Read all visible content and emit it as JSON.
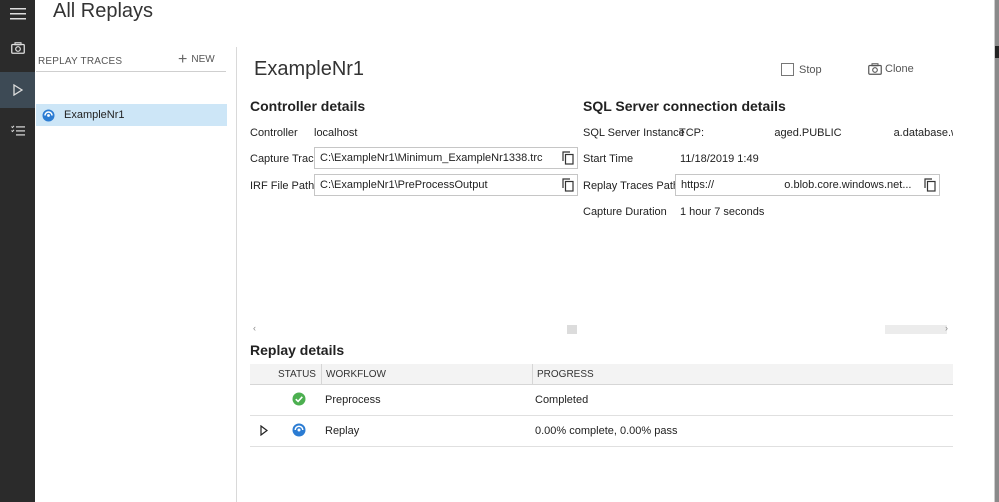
{
  "app": {
    "title": "All Replays"
  },
  "traces": {
    "header": "REPLAY TRACES",
    "new_label": "NEW",
    "items": [
      {
        "label": "ExampleNr1"
      }
    ]
  },
  "detail": {
    "title": "ExampleNr1",
    "stop_label": "Stop",
    "clone_label": "Clone",
    "controller": {
      "heading": "Controller details",
      "controller_label": "Controller",
      "controller_value": "localhost",
      "capture_trace_label": "Capture Trace",
      "capture_trace_value": "C:\\ExampleNr1\\Minimum_ExampleNr1338.trc",
      "irf_label": "IRF File Path",
      "irf_value": "C:\\ExampleNr1\\PreProcessOutput"
    },
    "sql": {
      "heading": "SQL Server connection details",
      "instance_label": "SQL Server Instance",
      "instance_value": "TCP:                       aged.PUBLIC                 a.database.windo",
      "start_label": "Start Time",
      "start_value": "11/18/2019 1:49",
      "replay_path_label": "Replay Traces Path",
      "replay_path_value": "https://                       o.blob.core.windows.net...",
      "duration_label": "Capture Duration",
      "duration_value": "1 hour 7 seconds"
    },
    "replay": {
      "heading": "Replay details",
      "columns": [
        "STATUS",
        "WORKFLOW",
        "PROGRESS"
      ],
      "rows": [
        {
          "status_icon": "check-circle-icon",
          "workflow": "Preprocess",
          "progress": "Completed"
        },
        {
          "status_icon": "in-progress-icon",
          "workflow": "Replay",
          "progress": "0.00% complete, 0.00% pass"
        }
      ]
    }
  },
  "colors": {
    "rail": "#2b2b2b",
    "selected": "#cde6f7",
    "success": "#4caf50",
    "running": "#2b7cd3"
  }
}
